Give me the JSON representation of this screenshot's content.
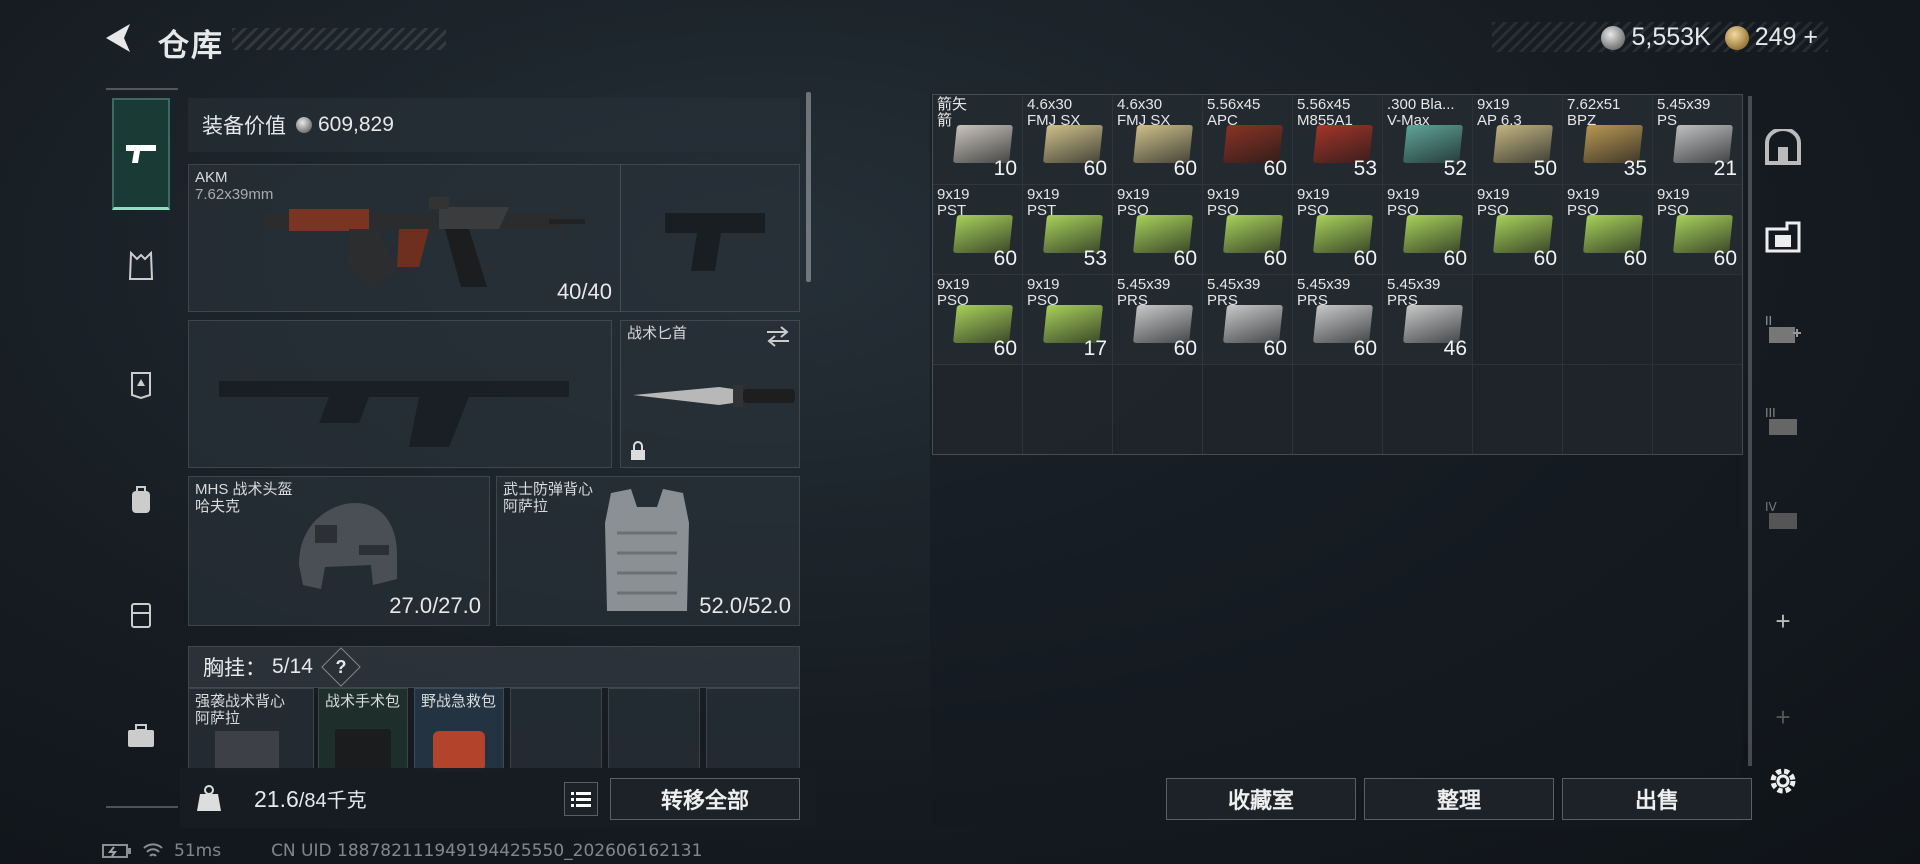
{
  "header": {
    "title": "仓库"
  },
  "currency": {
    "silver": "5,553K",
    "gold": "249"
  },
  "loadout": {
    "equip_value_label": "装备价值",
    "equip_value": "609,829",
    "primary": {
      "name": "AKM",
      "caliber": "7.62x39mm",
      "ammo": "40/40"
    },
    "melee": {
      "name": "战术匕首"
    },
    "helmet": {
      "name": "MHS 战术头盔",
      "sub": "哈夫克",
      "durability": "27.0/27.0"
    },
    "armor": {
      "name": "武士防弹背心",
      "sub": "阿萨拉",
      "durability": "52.0/52.0"
    },
    "vest": {
      "label": "胸挂：",
      "count": "5/14",
      "help": "?"
    },
    "vest_items": [
      {
        "name": "强袭战术背心",
        "sub": "阿萨拉"
      },
      {
        "name": "战术手术包",
        "sub": ""
      },
      {
        "name": "野战急救包",
        "sub": ""
      }
    ],
    "weight": {
      "current": "21.6",
      "max": "/84千克"
    },
    "transfer_all": "转移全部"
  },
  "stash": {
    "items": [
      {
        "name": "箭矢",
        "sub": "箭",
        "count": "10",
        "color": "#c9c4bc"
      },
      {
        "name": "4.6x30",
        "sub": "FMJ SX",
        "count": "60",
        "color": "#cdbf8a"
      },
      {
        "name": "4.6x30",
        "sub": "FMJ SX",
        "count": "60",
        "color": "#cdbf8a"
      },
      {
        "name": "5.56x45",
        "sub": "APC",
        "count": "60",
        "color": "#8a3324"
      },
      {
        "name": "5.56x45",
        "sub": "M855A1",
        "count": "53",
        "color": "#a3352a"
      },
      {
        "name": ".300 Bla...",
        "sub": "V-Max",
        "count": "52",
        "color": "#5fa398"
      },
      {
        "name": "9x19",
        "sub": "AP 6.3",
        "count": "50",
        "color": "#c2b482"
      },
      {
        "name": "7.62x51",
        "sub": "BPZ",
        "count": "35",
        "color": "#b89654"
      },
      {
        "name": "5.45x39",
        "sub": "PS",
        "count": "21",
        "color": "#bfbfbf"
      },
      {
        "name": "9x19",
        "sub": "PST",
        "count": "60",
        "color": "#a8d05a"
      },
      {
        "name": "9x19",
        "sub": "PST",
        "count": "53",
        "color": "#a8d05a"
      },
      {
        "name": "9x19",
        "sub": "PSO",
        "count": "60",
        "color": "#a8d05a"
      },
      {
        "name": "9x19",
        "sub": "PSO",
        "count": "60",
        "color": "#a8d05a"
      },
      {
        "name": "9x19",
        "sub": "PSO",
        "count": "60",
        "color": "#a8d05a"
      },
      {
        "name": "9x19",
        "sub": "PSO",
        "count": "60",
        "color": "#a8d05a"
      },
      {
        "name": "9x19",
        "sub": "PSO",
        "count": "60",
        "color": "#a8d05a"
      },
      {
        "name": "9x19",
        "sub": "PSO",
        "count": "60",
        "color": "#a8d05a"
      },
      {
        "name": "9x19",
        "sub": "PSO",
        "count": "60",
        "color": "#a8d05a"
      },
      {
        "name": "9x19",
        "sub": "PSO",
        "count": "60",
        "color": "#a8d05a"
      },
      {
        "name": "9x19",
        "sub": "PSO",
        "count": "17",
        "color": "#a8d05a"
      },
      {
        "name": "5.45x39",
        "sub": "PRS",
        "count": "60",
        "color": "#c8c8c8"
      },
      {
        "name": "5.45x39",
        "sub": "PRS",
        "count": "60",
        "color": "#c8c8c8"
      },
      {
        "name": "5.45x39",
        "sub": "PRS",
        "count": "60",
        "color": "#c8c8c8"
      },
      {
        "name": "5.45x39",
        "sub": "PRS",
        "count": "46",
        "color": "#c8c8c8"
      }
    ],
    "buttons": {
      "collection": "收藏室",
      "sort": "整理",
      "sell": "出售"
    }
  },
  "status": {
    "ping": "51ms",
    "uid": "CN UID 188782111949194425550_202606162131"
  }
}
